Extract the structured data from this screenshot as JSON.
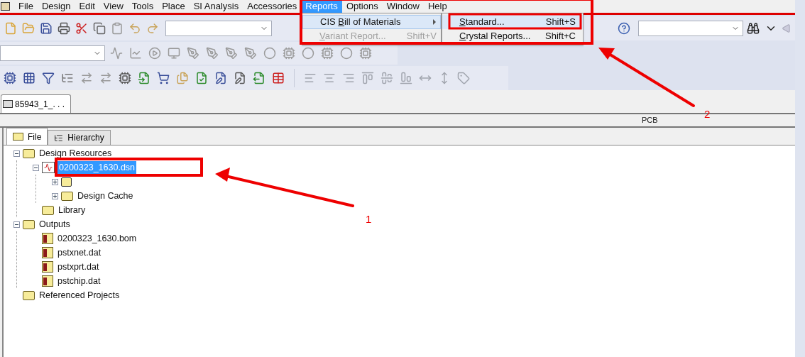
{
  "menu_bar": {
    "items": [
      {
        "label": "File",
        "selected": false
      },
      {
        "label": "Design",
        "selected": false
      },
      {
        "label": "Edit",
        "selected": false
      },
      {
        "label": "View",
        "selected": false
      },
      {
        "label": "Tools",
        "selected": false
      },
      {
        "label": "Place",
        "selected": false
      },
      {
        "label": "SI Analysis",
        "selected": false
      },
      {
        "label": "Accessories",
        "selected": false
      },
      {
        "label": "Reports",
        "selected": true
      },
      {
        "label": "Options",
        "selected": false
      },
      {
        "label": "Window",
        "selected": false
      },
      {
        "label": "Help",
        "selected": false
      }
    ]
  },
  "reports_menu": {
    "items": [
      {
        "pre": "CIS ",
        "key": "B",
        "post": "ill of Materials",
        "highlighted": true,
        "disabled": false,
        "submenu": true
      },
      {
        "key": "V",
        "post": "ariant Report...",
        "shortcut": "Shift+V",
        "highlighted": false,
        "disabled": true,
        "submenu": false
      }
    ]
  },
  "bom_submenu": {
    "items": [
      {
        "key": "S",
        "post": "tandard...",
        "shortcut": "Shift+S",
        "highlighted": true
      },
      {
        "key": "C",
        "post": "rystal Reports...",
        "shortcut": "Shift+C",
        "highlighted": false
      }
    ]
  },
  "document_tab": {
    "label": "85943_1_. . ."
  },
  "header": {
    "label": "PCB"
  },
  "panel_tabs": [
    {
      "label": "File",
      "selected": true
    },
    {
      "label": "Hierarchy",
      "selected": false
    }
  ],
  "tree": [
    {
      "label": "Design Resources",
      "kind": "folder",
      "expanded": true,
      "children": [
        {
          "label": "0200323_1630.dsn",
          "kind": "design",
          "selected": true,
          "expanded": true,
          "children": [
            {
              "kind": "schematic",
              "expanded": false
            },
            {
              "label": "Design Cache",
              "kind": "folder",
              "expanded": false
            }
          ]
        },
        {
          "label": "Library",
          "kind": "folder"
        }
      ]
    },
    {
      "label": "Outputs",
      "kind": "folder",
      "expanded": true,
      "children": [
        {
          "label": "0200323_1630.bom",
          "kind": "report"
        },
        {
          "label": "pstxnet.dat",
          "kind": "report"
        },
        {
          "label": "pstxprt.dat",
          "kind": "report"
        },
        {
          "label": "pstchip.dat",
          "kind": "report"
        }
      ]
    },
    {
      "label": "Referenced Projects",
      "kind": "folder"
    }
  ],
  "annotations": [
    {
      "number": "1"
    },
    {
      "number": "2"
    }
  ]
}
